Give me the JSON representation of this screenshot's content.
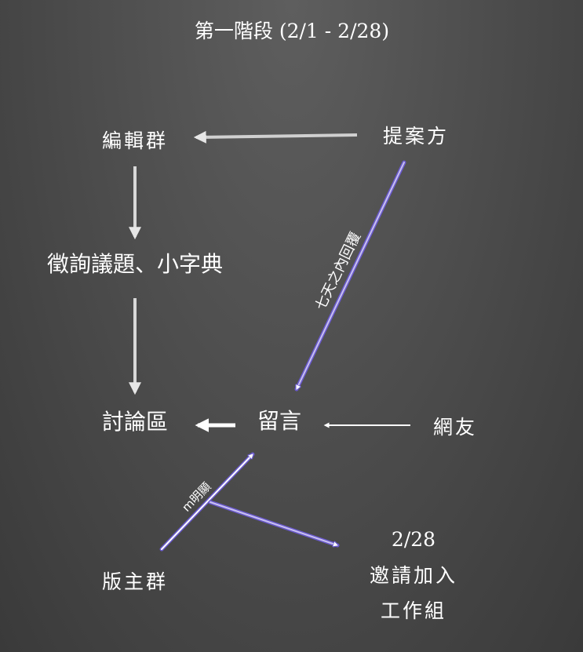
{
  "title": "第一階段 (2/1 - 2/28)",
  "nodes": {
    "editors": "編輯群",
    "proposer": "提案方",
    "collect": "徵詢議題、小字典",
    "forum": "討論區",
    "comment": "留言",
    "netizens": "網友",
    "moderators": "版主群",
    "invite_date": "2/28",
    "invite_line1": "邀請加入",
    "invite_line2": "工作組"
  },
  "edge_labels": {
    "reply": "七天之內回覆",
    "obvious": "m明顯"
  },
  "colors": {
    "accent": "#6a5acd",
    "arrow": "#e0e0e0",
    "text": "#ffffff"
  }
}
